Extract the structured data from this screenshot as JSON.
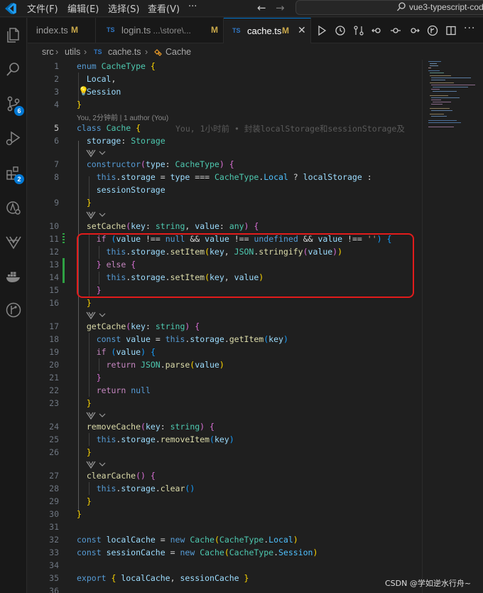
{
  "titlebar": {
    "menus": [
      "文件(F)",
      "编辑(E)",
      "选择(S)",
      "查看(V)",
      "···"
    ],
    "search_text": "vue3-typescript-cod"
  },
  "activity": {
    "badges": {
      "source_control": "6",
      "extensions": "2"
    }
  },
  "tabs": [
    {
      "name": "index.ts",
      "desc": "",
      "mod": "M",
      "active": false,
      "icon": ""
    },
    {
      "name": "login.ts",
      "desc": " ...\\store\\...",
      "mod": "M",
      "active": false,
      "icon": "TS"
    },
    {
      "name": "cache.ts",
      "desc": "",
      "mod": "M",
      "active": true,
      "icon": "TS"
    }
  ],
  "breadcrumb": {
    "parts": [
      "src",
      "utils",
      "TS",
      "cache.ts",
      "Cache"
    ]
  },
  "editor": {
    "blame_line": "You, 2分钟前 | 1 author (You)",
    "inline_blame": "You, 1小时前 • 封装localStorage和sessionStorage及",
    "line_numbers": [
      "1",
      "2",
      "3",
      "4",
      "5",
      "6",
      "7",
      "8",
      "9",
      "10",
      "11",
      "12",
      "13",
      "14",
      "15",
      "16",
      "17",
      "18",
      "19",
      "20",
      "21",
      "22",
      "23",
      "24",
      "25",
      "26",
      "27",
      "28",
      "29",
      "30",
      "31",
      "32",
      "33",
      "34",
      "35",
      "36"
    ],
    "code": [
      "enum CacheType {",
      "  Local,",
      "  Session",
      "}",
      "class Cache {",
      "  storage: Storage",
      "  constructor(type: CacheType) {",
      "    this.storage = type === CacheType.Local ? localStorage :",
      "    sessionStorage",
      "  }",
      "  setCache(key: string, value: any) {",
      "    if (value !== null && value !== undefined && value !== '') {",
      "      this.storage.setItem(key, JSON.stringify(value))",
      "    } else {",
      "      this.storage.setItem(key, value)",
      "    }",
      "  }",
      "  getCache(key: string) {",
      "    const value = this.storage.getItem(key)",
      "    if (value) {",
      "      return JSON.parse(value)",
      "    }",
      "    return null",
      "  }",
      "  removeCache(key: string) {",
      "    this.storage.removeItem(key)",
      "  }",
      "  clearCache() {",
      "    this.storage.clear()",
      "  }",
      "}",
      "",
      "const localCache = new Cache(CacheType.Local)",
      "const sessionCache = new Cache(CacheType.Session)",
      "",
      "export { localCache, sessionCache }",
      ""
    ]
  },
  "watermark": "CSDN @学如逆水行舟~"
}
